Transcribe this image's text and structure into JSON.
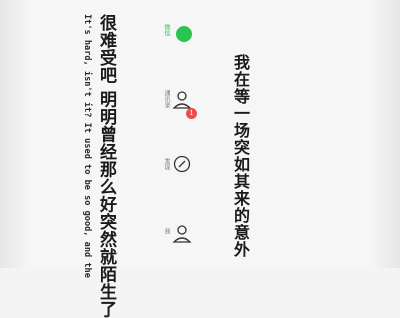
{
  "post": {
    "headline": "我在等一场突如其来的意外",
    "lyric_cn": "很难受吧 明明曾经那么好突然就陌生了",
    "lyric_en": "It's hard, isn't it? It used to be so good, and the"
  },
  "tabbar": {
    "chats_label": "微信",
    "contacts_label": "通讯录",
    "contacts_badge": "1",
    "discover_label": "发现",
    "me_label": "我"
  },
  "colors": {
    "accent": "#2bc451",
    "badge": "#f04b4b",
    "background": "#f6f6f6"
  }
}
